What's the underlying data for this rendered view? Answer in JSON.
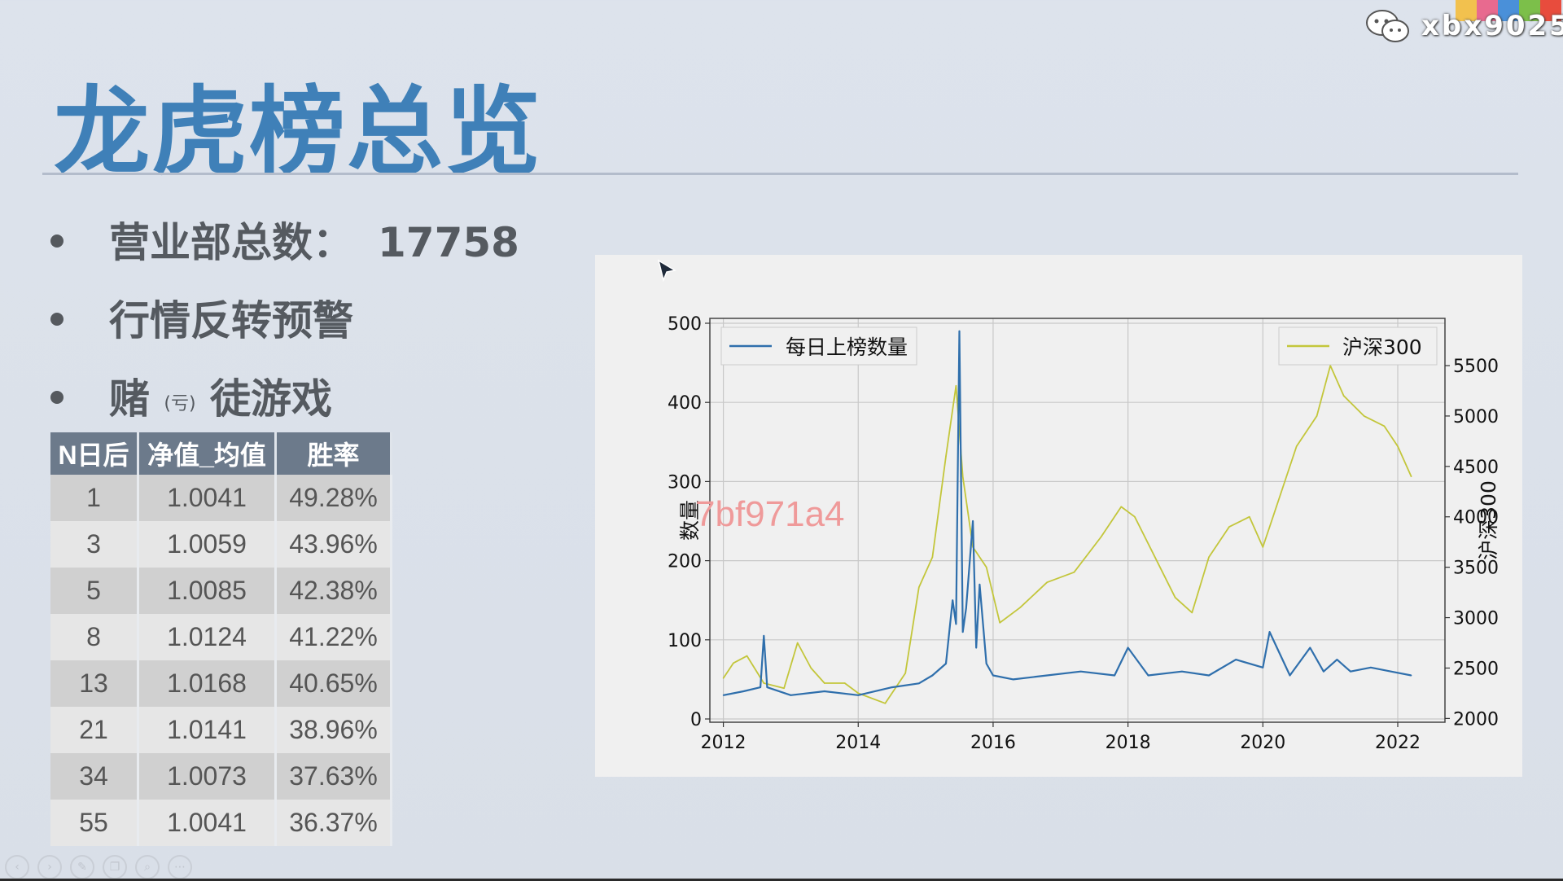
{
  "slide": {
    "title": "龙虎榜总览",
    "bullets": [
      {
        "text": "营业部总数：",
        "value": "17758"
      },
      {
        "text": "行情反转预警"
      },
      {
        "text_a": "赌",
        "small": "(亏)",
        "text_b": "徒游戏"
      }
    ]
  },
  "table": {
    "headers": [
      "N日后",
      "净值_均值",
      "胜率"
    ],
    "rows": [
      [
        "1",
        "1.0041",
        "49.28%"
      ],
      [
        "3",
        "1.0059",
        "43.96%"
      ],
      [
        "5",
        "1.0085",
        "42.38%"
      ],
      [
        "8",
        "1.0124",
        "41.22%"
      ],
      [
        "13",
        "1.0168",
        "40.65%"
      ],
      [
        "21",
        "1.0141",
        "38.96%"
      ],
      [
        "34",
        "1.0073",
        "37.63%"
      ],
      [
        "55",
        "1.0041",
        "36.37%"
      ]
    ]
  },
  "watermark": {
    "chart_id": "7bf971a4",
    "brand": "xbx9025",
    "brand_colors": [
      "#f2c14e",
      "#e86a8f",
      "#4a90d9",
      "#7cbf4a",
      "#e84c3d"
    ]
  },
  "toolbar_icons": [
    "prev-icon",
    "next-icon",
    "pen-icon",
    "copy-icon",
    "zoom-icon",
    "more-icon"
  ],
  "chart_data": {
    "type": "line",
    "x_ticks": [
      "2012",
      "2014",
      "2016",
      "2018",
      "2020",
      "2022"
    ],
    "left_axis": {
      "label": "数量",
      "ticks": [
        "0",
        "100",
        "200",
        "300",
        "400",
        "500"
      ],
      "ylim": [
        0,
        500
      ]
    },
    "right_axis": {
      "label": "沪深300",
      "ticks": [
        "2000",
        "2500",
        "3000",
        "3500",
        "4000",
        "4500",
        "5000",
        "5500"
      ],
      "ylim": [
        1995,
        5920
      ]
    },
    "xlim": [
      2011.8,
      2022.7
    ],
    "grid": true,
    "legend": [
      {
        "label": "每日上榜数量",
        "placement": "top-left"
      },
      {
        "label": "沪深300",
        "placement": "top-right"
      }
    ],
    "series": [
      {
        "name": "每日上榜数量",
        "axis": "left",
        "color": "#2f6fac",
        "x": [
          2012.0,
          2012.3,
          2012.55,
          2012.6,
          2012.65,
          2013.0,
          2013.5,
          2014.0,
          2014.5,
          2014.9,
          2015.1,
          2015.3,
          2015.4,
          2015.45,
          2015.5,
          2015.55,
          2015.6,
          2015.7,
          2015.75,
          2015.8,
          2015.9,
          2016.0,
          2016.3,
          2016.8,
          2017.3,
          2017.8,
          2018.0,
          2018.3,
          2018.8,
          2019.2,
          2019.6,
          2020.0,
          2020.1,
          2020.4,
          2020.7,
          2020.9,
          2021.1,
          2021.3,
          2021.6,
          2021.9,
          2022.2
        ],
        "y": [
          30,
          35,
          40,
          105,
          40,
          30,
          35,
          30,
          40,
          45,
          55,
          70,
          150,
          120,
          490,
          110,
          140,
          250,
          90,
          170,
          70,
          55,
          50,
          55,
          60,
          55,
          90,
          55,
          60,
          55,
          75,
          65,
          110,
          55,
          90,
          60,
          75,
          60,
          65,
          60,
          55
        ]
      },
      {
        "name": "沪深300",
        "axis": "right",
        "color": "#c3c63b",
        "x": [
          2012.0,
          2012.15,
          2012.35,
          2012.6,
          2012.9,
          2013.1,
          2013.3,
          2013.5,
          2013.8,
          2014.0,
          2014.4,
          2014.7,
          2014.9,
          2015.1,
          2015.3,
          2015.45,
          2015.55,
          2015.7,
          2015.9,
          2016.1,
          2016.4,
          2016.8,
          2017.2,
          2017.6,
          2017.9,
          2018.1,
          2018.4,
          2018.7,
          2018.95,
          2019.2,
          2019.5,
          2019.8,
          2020.0,
          2020.2,
          2020.5,
          2020.8,
          2021.0,
          2021.2,
          2021.5,
          2021.8,
          2022.0,
          2022.2
        ],
        "y": [
          2400,
          2550,
          2620,
          2350,
          2300,
          2750,
          2500,
          2350,
          2350,
          2250,
          2150,
          2450,
          3300,
          3600,
          4600,
          5300,
          4400,
          3700,
          3500,
          2950,
          3100,
          3350,
          3450,
          3800,
          4100,
          4000,
          3600,
          3200,
          3050,
          3600,
          3900,
          4000,
          3700,
          4100,
          4700,
          5000,
          5500,
          5200,
          5000,
          4900,
          4700,
          4400
        ]
      }
    ]
  }
}
